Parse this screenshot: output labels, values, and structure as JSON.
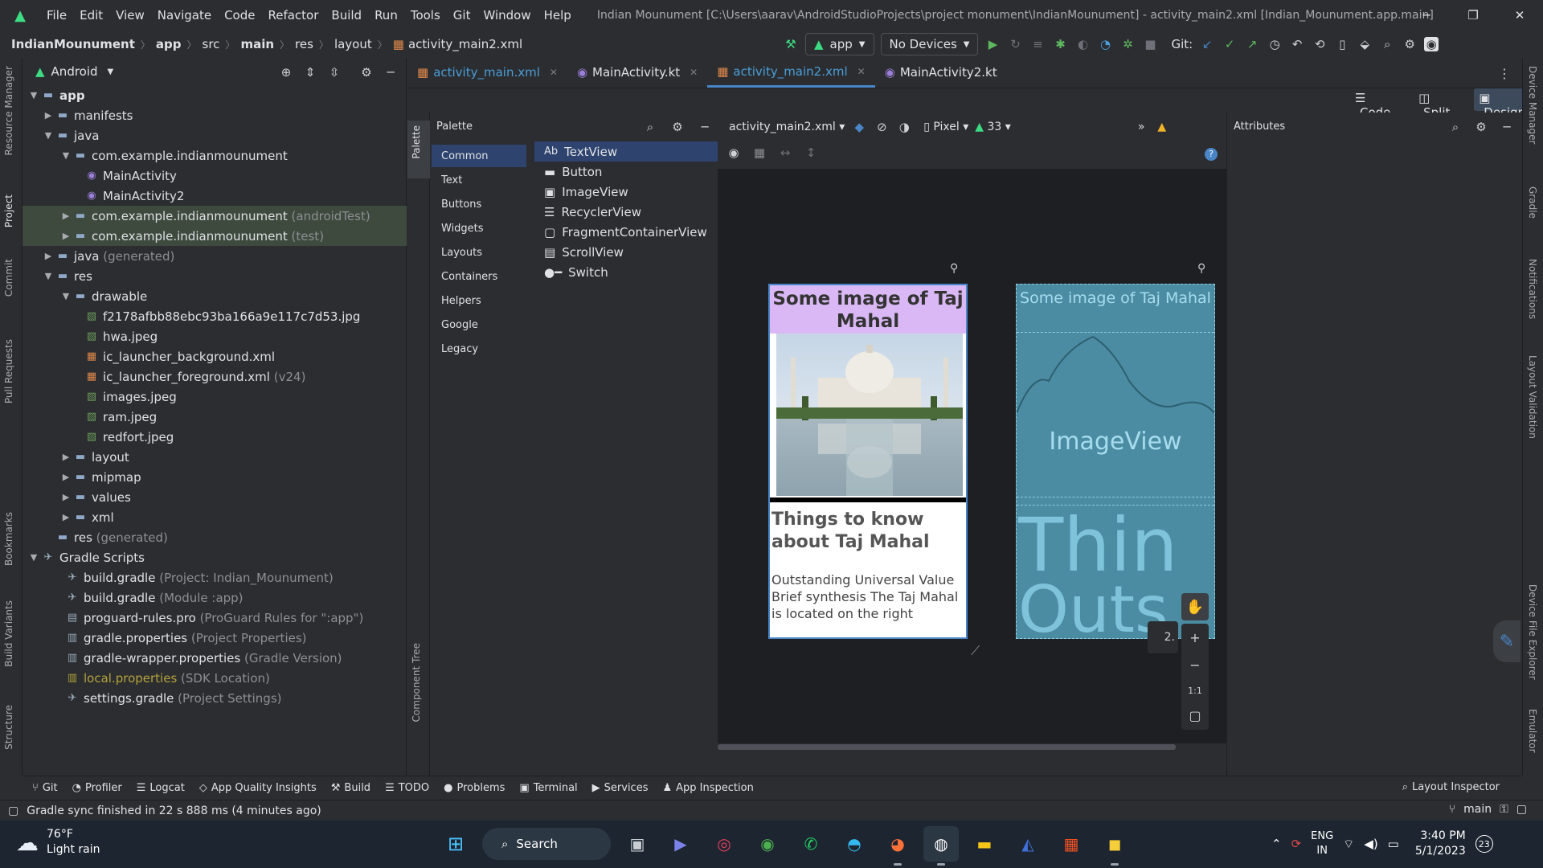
{
  "titlebar": {
    "menu": [
      "File",
      "Edit",
      "View",
      "Navigate",
      "Code",
      "Refactor",
      "Build",
      "Run",
      "Tools",
      "Git",
      "Window",
      "Help"
    ],
    "title": "Indian Mounument [C:\\Users\\aarav\\AndroidStudioProjects\\project monument\\IndianMounument] - activity_main2.xml [Indian_Mounument.app.main]"
  },
  "navbar": {
    "crumbs": [
      "IndianMounument",
      "app",
      "src",
      "main",
      "res",
      "layout",
      "activity_main2.xml"
    ],
    "run_config": "app",
    "device": "No Devices",
    "git_label": "Git:"
  },
  "left_strip": [
    "Resource Manager",
    "Project",
    "Commit",
    "Pull Requests",
    "Bookmarks",
    "Build Variants",
    "Structure"
  ],
  "right_strip": [
    "Device Manager",
    "Gradle",
    "Notifications",
    "Layout Validation",
    "Device File Explorer",
    "Emulator"
  ],
  "project": {
    "view": "Android",
    "tree": [
      {
        "label": "app",
        "bold": true
      },
      {
        "label": "manifests"
      },
      {
        "label": "java"
      },
      {
        "label": "com.example.indianmounument"
      },
      {
        "label": "MainActivity"
      },
      {
        "label": "MainActivity2"
      },
      {
        "label": "com.example.indianmounument",
        "suffix": "(androidTest)"
      },
      {
        "label": "com.example.indianmounument",
        "suffix": "(test)"
      },
      {
        "label": "java",
        "suffix": "(generated)"
      },
      {
        "label": "res"
      },
      {
        "label": "drawable"
      },
      {
        "label": "f2178afbb88ebc93ba166a9e117c7d53.jpg"
      },
      {
        "label": "hwa.jpeg"
      },
      {
        "label": "ic_launcher_background.xml"
      },
      {
        "label": "ic_launcher_foreground.xml",
        "suffix": "(v24)"
      },
      {
        "label": "images.jpeg"
      },
      {
        "label": "ram.jpeg"
      },
      {
        "label": "redfort.jpeg"
      },
      {
        "label": "layout"
      },
      {
        "label": "mipmap"
      },
      {
        "label": "values"
      },
      {
        "label": "xml"
      },
      {
        "label": "res",
        "suffix": "(generated)"
      },
      {
        "label": "Gradle Scripts"
      },
      {
        "label": "build.gradle",
        "suffix": "(Project: Indian_Mounument)"
      },
      {
        "label": "build.gradle",
        "suffix": "(Module :app)"
      },
      {
        "label": "proguard-rules.pro",
        "suffix": "(ProGuard Rules for \":app\")"
      },
      {
        "label": "gradle.properties",
        "suffix": "(Project Properties)"
      },
      {
        "label": "gradle-wrapper.properties",
        "suffix": "(Gradle Version)"
      },
      {
        "label": "local.properties",
        "suffix": "(SDK Location)"
      },
      {
        "label": "settings.gradle",
        "suffix": "(Project Settings)"
      }
    ]
  },
  "editor_tabs": [
    "activity_main.xml",
    "MainActivity.kt",
    "activity_main2.xml",
    "MainActivity2.kt"
  ],
  "view_modes": [
    "Code",
    "Split",
    "Design"
  ],
  "palette": {
    "title": "Palette",
    "strip_label": "Palette",
    "component_tree_label": "Component Tree",
    "categories": [
      "Common",
      "Text",
      "Buttons",
      "Widgets",
      "Layouts",
      "Containers",
      "Helpers",
      "Google",
      "Legacy"
    ],
    "items": [
      "TextView",
      "Button",
      "ImageView",
      "RecyclerView",
      "FragmentContainerView",
      "ScrollView",
      "Switch"
    ]
  },
  "design_toolbar": {
    "file": "activity_main2.xml",
    "device": "Pixel",
    "api": "33"
  },
  "attributes_title": "Attributes",
  "preview": {
    "header": "Some image of Taj Mahal",
    "heading": "Things to know about Taj Mahal",
    "paragraph": "Outstanding Universal Value Brief synthesis  The Taj Mahal is located on the right",
    "blueprint_header": "Some image of Taj Mahal",
    "blueprint_image_label": "ImageView",
    "blueprint_big_text": "Thin",
    "blueprint_big_text2": "Outs",
    "zoom_partial": "2.",
    "zoom_ratio": "1:1"
  },
  "bottom_tools": [
    "Git",
    "Profiler",
    "Logcat",
    "App Quality Insights",
    "Build",
    "TODO",
    "Problems",
    "Terminal",
    "Services",
    "App Inspection"
  ],
  "layout_inspector": "Layout Inspector",
  "status": {
    "message": "Gradle sync finished in 22 s 888 ms (4 minutes ago)",
    "branch": "main"
  },
  "taskbar": {
    "weather_temp": "76°F",
    "weather_desc": "Light rain",
    "search": "Search",
    "lang1": "ENG",
    "lang2": "IN",
    "time": "3:40 PM",
    "date": "5/1/2023",
    "badge": "23"
  },
  "colors": {
    "accent": "#4a86c7",
    "header_purple": "#d9b8f5",
    "blueprint": "#4b8ca3"
  }
}
